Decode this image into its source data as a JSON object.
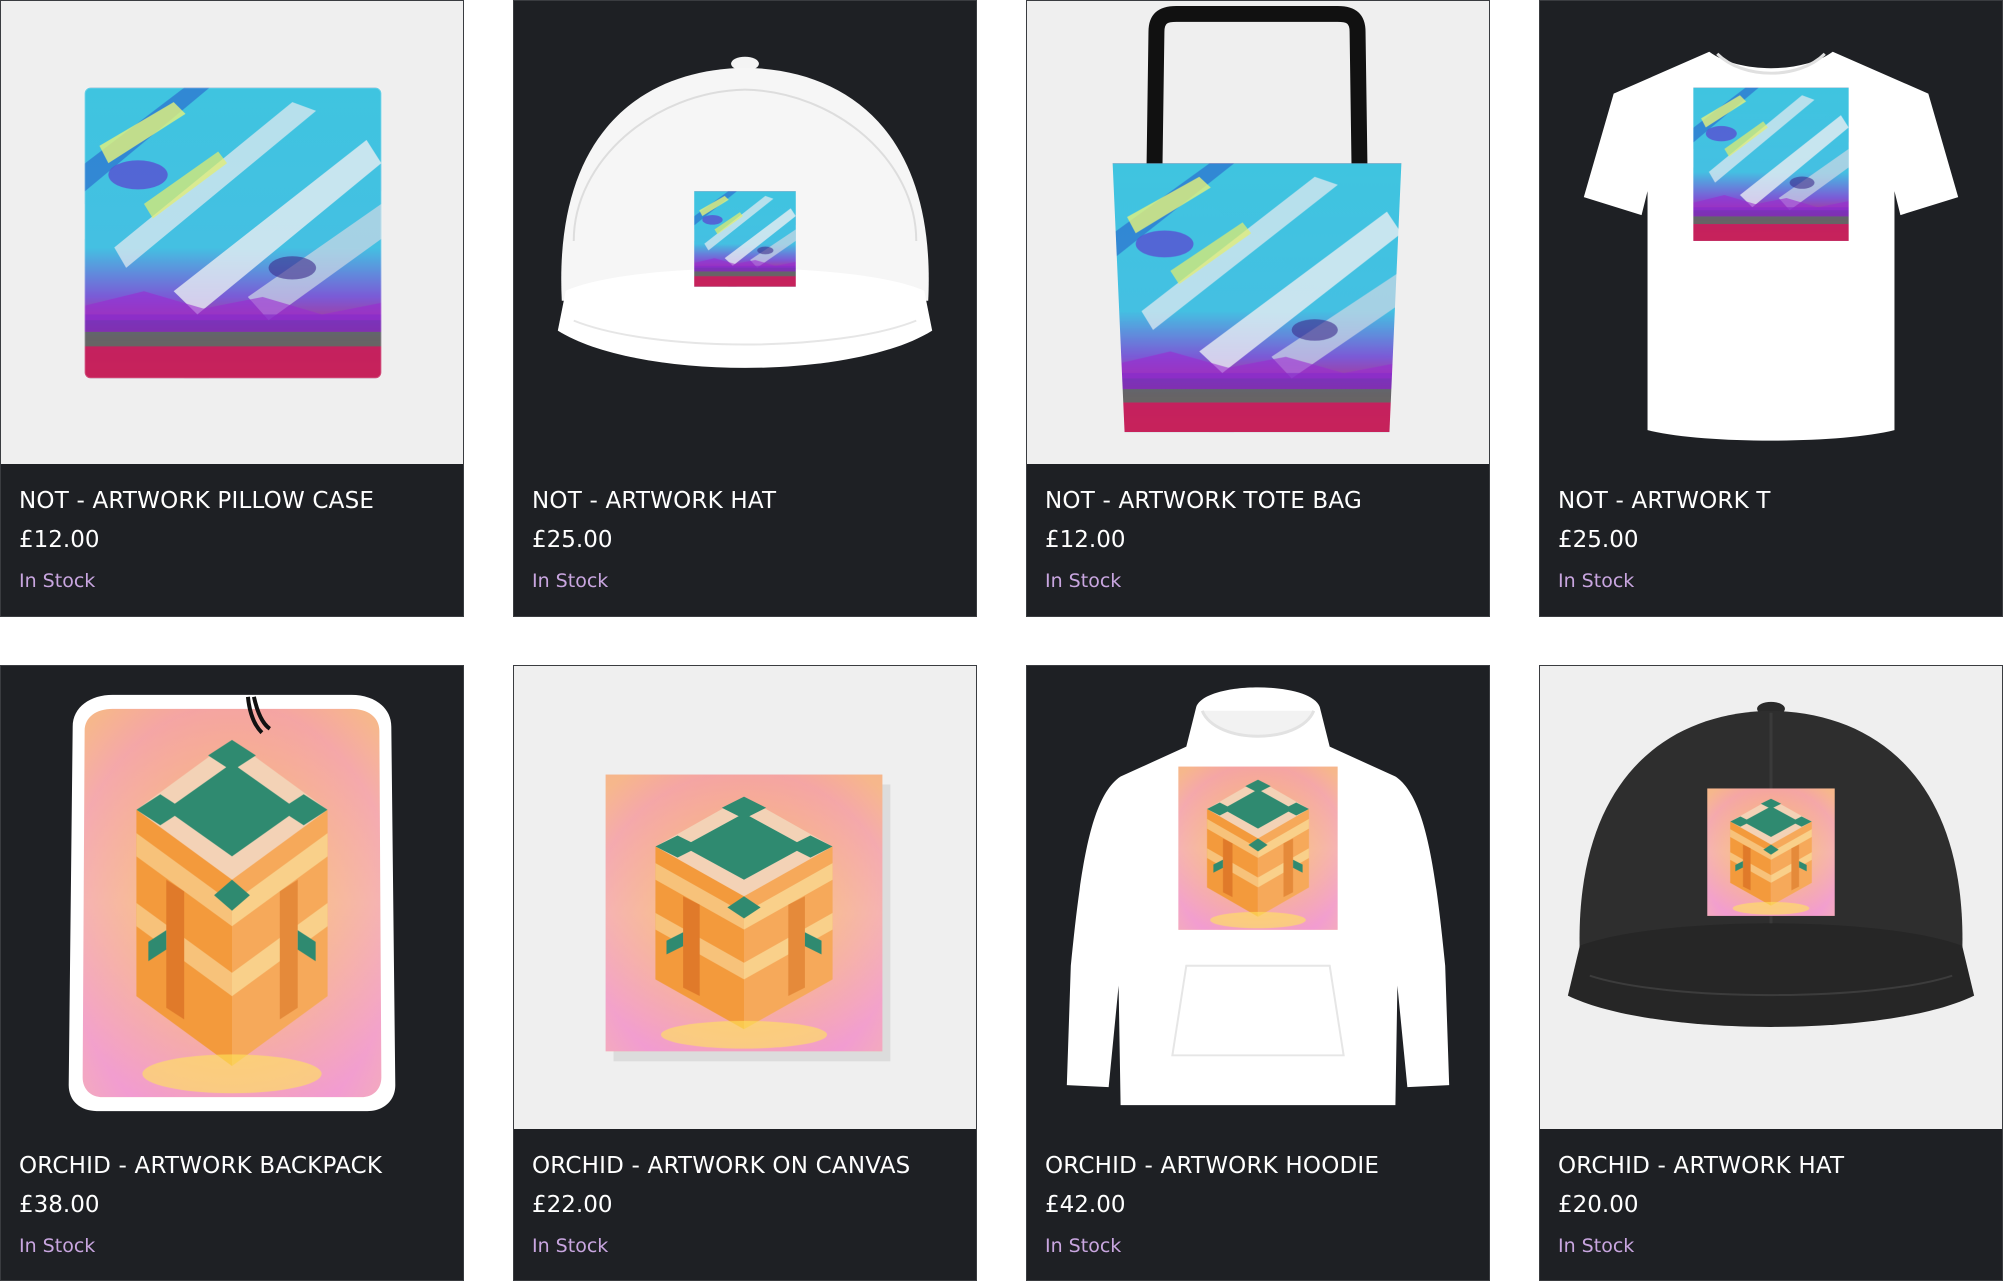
{
  "colors": {
    "card_background": "#1e2024",
    "light_image_background": "#efefef",
    "title_text": "#ffffff",
    "stock_text": "#c9a6e0"
  },
  "products": [
    {
      "title": "NOT - ARTWORK PILLOW CASE",
      "price": "£12.00",
      "stock": "In Stock",
      "artwork": "not-artwork",
      "item": "pillow-case"
    },
    {
      "title": "NOT - ARTWORK HAT",
      "price": "£25.00",
      "stock": "In Stock",
      "artwork": "not-artwork",
      "item": "snapback-hat"
    },
    {
      "title": "NOT - ARTWORK TOTE BAG",
      "price": "£12.00",
      "stock": "In Stock",
      "artwork": "not-artwork",
      "item": "tote-bag"
    },
    {
      "title": "NOT - ARTWORK T",
      "price": "£25.00",
      "stock": "In Stock",
      "artwork": "not-artwork",
      "item": "t-shirt"
    },
    {
      "title": "ORCHID - ARTWORK BACKPACK",
      "price": "£38.00",
      "stock": "In Stock",
      "artwork": "orchid-artwork",
      "item": "backpack"
    },
    {
      "title": "ORCHID - ARTWORK ON CANVAS",
      "price": "£22.00",
      "stock": "In Stock",
      "artwork": "orchid-artwork",
      "item": "canvas"
    },
    {
      "title": "ORCHID - ARTWORK HOODIE",
      "price": "£42.00",
      "stock": "In Stock",
      "artwork": "orchid-artwork",
      "item": "hoodie"
    },
    {
      "title": "ORCHID - ARTWORK HAT",
      "price": "£20.00",
      "stock": "In Stock",
      "artwork": "orchid-artwork",
      "item": "dad-hat"
    }
  ]
}
